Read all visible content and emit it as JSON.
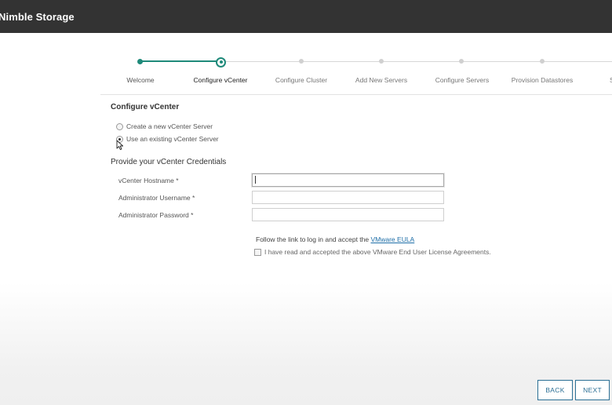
{
  "header": {
    "brand": "Nimble Storage"
  },
  "stepper": {
    "steps": [
      {
        "label": "Welcome",
        "state": "done"
      },
      {
        "label": "Configure vCenter",
        "state": "current"
      },
      {
        "label": "Configure Cluster",
        "state": "todo"
      },
      {
        "label": "Add New Servers",
        "state": "todo"
      },
      {
        "label": "Configure Servers",
        "state": "todo"
      },
      {
        "label": "Provision Datastores",
        "state": "todo"
      },
      {
        "label": "S",
        "state": "todo"
      }
    ]
  },
  "vcenter": {
    "title": "Configure vCenter",
    "option_new": "Create a new vCenter Server",
    "option_existing": "Use an existing vCenter Server",
    "selected": "existing"
  },
  "credentials": {
    "title": "Provide your vCenter Credentials",
    "hostname_label": "vCenter Hostname *",
    "hostname_value": "",
    "username_label": "Administrator Username *",
    "username_value": "",
    "password_label": "Administrator Password *",
    "password_value": ""
  },
  "eula": {
    "prompt": "Follow the link to log in and accept the ",
    "link_text": "VMware EULA",
    "accept_label": "I have read and accepted the above VMware End User License Agreements."
  },
  "footer": {
    "back_label": "BACK",
    "next_label": "NEXT"
  },
  "colors": {
    "header_bg": "#333333",
    "accent": "#1f8a7a",
    "button": "#2b6f95"
  }
}
